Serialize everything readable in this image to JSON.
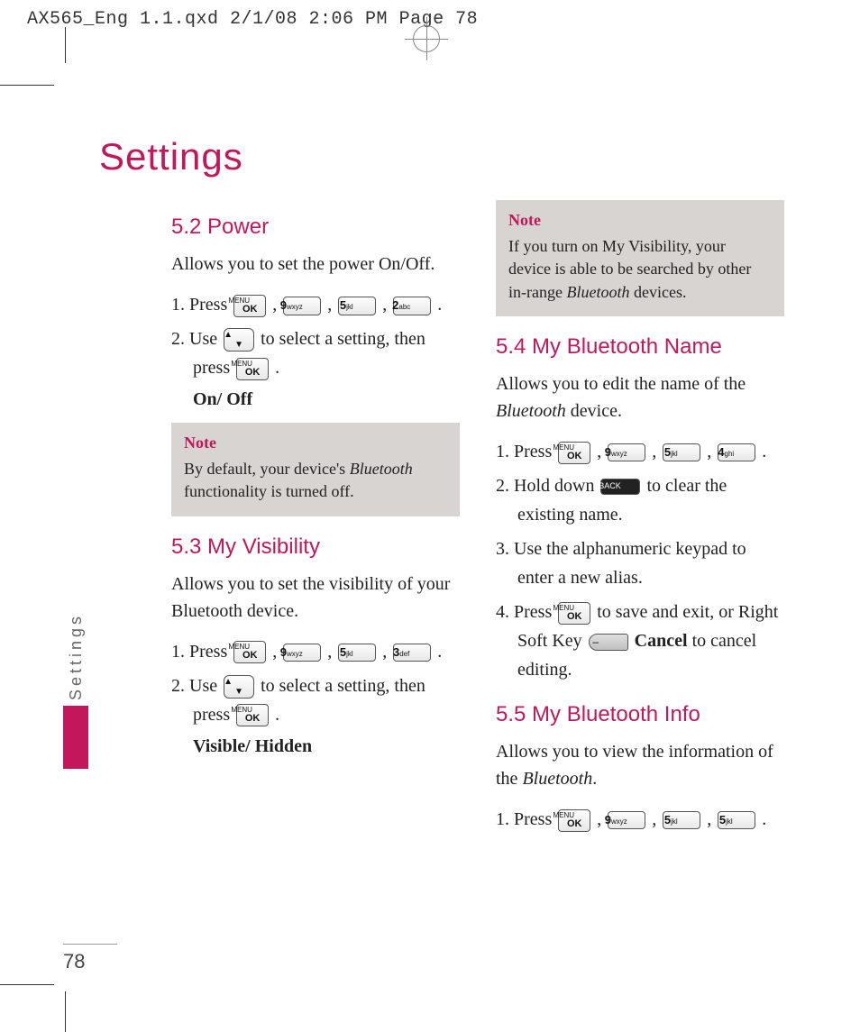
{
  "header": {
    "slug": "AX565_Eng 1.1.qxd  2/1/08  2:06 PM  Page 78"
  },
  "page": {
    "title": "Settings",
    "side_tab": "Settings",
    "number": "78"
  },
  "keys": {
    "menu_top": "MENU",
    "menu_ok": "OK",
    "k9": "9",
    "k9_sub": "wxyz",
    "k5": "5",
    "k5_sub": "jkl",
    "k2": "2",
    "k2_sub": "abc",
    "k3": "3",
    "k3_sub": "def",
    "k4": "4",
    "k4_sub": "ghi",
    "nav": "▲\n▼",
    "back": "BACK",
    "soft": "–"
  },
  "col1": {
    "s52": {
      "heading": "5.2 Power",
      "intro": "Allows you to set the power On/Off.",
      "step1a": "1. Press ",
      "step2a": "2. Use ",
      "step2b": " to select a setting, then press ",
      "options": "On/ Off",
      "note_label": "Note",
      "note_text_a": "By default, your device's ",
      "note_text_b": "Bluetooth",
      "note_text_c": " functionality is turned off."
    },
    "s53": {
      "heading": "5.3 My Visibility",
      "intro": "Allows you to set the visibility of your Bluetooth device.",
      "step1a": "1. Press ",
      "step2a": "2. Use ",
      "step2b": " to select a setting, then press ",
      "options": "Visible/ Hidden"
    }
  },
  "col2": {
    "topnote": {
      "label": "Note",
      "text_a": "If you turn on My Visibility, your device is able to be searched by other in-range ",
      "text_b": "Bluetooth",
      "text_c": " devices."
    },
    "s54": {
      "heading": "5.4 My Bluetooth Name",
      "intro_a": "Allows you to edit the name of the ",
      "intro_b": "Bluetooth",
      "intro_c": " device.",
      "step1a": "1. Press ",
      "step2a": "2. Hold down ",
      "step2b": " to clear the existing name.",
      "step3": "3. Use the alphanumeric keypad to enter a new alias.",
      "step4a": "4. Press ",
      "step4b": " to save and exit, or Right Soft Key ",
      "step4c": "Cancel",
      "step4d": " to cancel editing."
    },
    "s55": {
      "heading": "5.5 My Bluetooth Info",
      "intro_a": "Allows you to view the information of the ",
      "intro_b": "Bluetooth",
      "intro_c": ".",
      "step1a": "1. Press "
    }
  }
}
